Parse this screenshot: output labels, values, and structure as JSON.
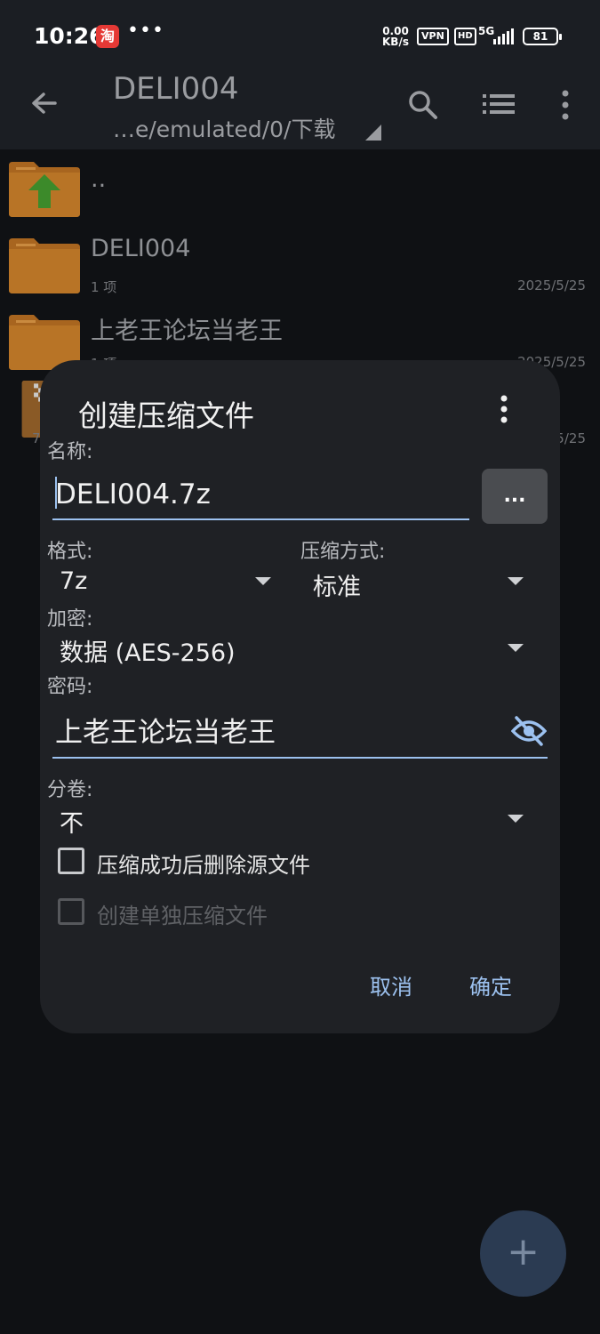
{
  "status_bar": {
    "time": "10:26",
    "app_badge": "淘",
    "dots": "•••",
    "speed_value": "0.00",
    "speed_unit": "KB/s",
    "vpn": "VPN",
    "hd": "HD",
    "network": "5G",
    "battery": "81"
  },
  "app_bar": {
    "title": "DELI004",
    "subtitle": "…e/emulated/0/下载"
  },
  "files": [
    {
      "name": "..",
      "meta": "",
      "date": ""
    },
    {
      "name": "DELI004",
      "meta": "1 项",
      "date": "2025/5/25"
    },
    {
      "name": "上老王论坛当老王",
      "meta": "1 项",
      "date": "2025/5/25"
    },
    {
      "name": "",
      "meta": "7",
      "date": "2025/5/25"
    }
  ],
  "dialog": {
    "title": "创建压缩文件",
    "name_label": "名称:",
    "name_value": "DELI004.7z",
    "browse_label": "...",
    "format_label": "格式:",
    "format_value": "7z",
    "compression_label": "压缩方式:",
    "compression_value": "标准",
    "encryption_label": "加密:",
    "encryption_value": "数据 (AES-256)",
    "password_label": "密码:",
    "password_value": "上老王论坛当老王",
    "volume_label": "分卷:",
    "volume_value": "不",
    "delete_after_label": "压缩成功后删除源文件",
    "separate_label": "创建单独压缩文件",
    "cancel_label": "取消",
    "ok_label": "确定"
  },
  "fab_label": "+",
  "colors": {
    "accent": "#9cc1ef",
    "dialog_bg": "#1f2125",
    "folder": "#d98b2b",
    "background": "#0f1114"
  }
}
